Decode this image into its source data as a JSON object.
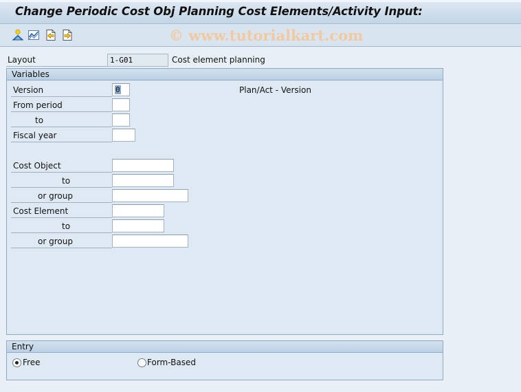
{
  "window": {
    "title": "Change Periodic Cost Obj Planning Cost Elements/Activity Input:"
  },
  "toolbar": {
    "icons": [
      {
        "name": "user-settings-icon",
        "label": "Settings"
      },
      {
        "name": "chart-icon",
        "label": "Graphic"
      },
      {
        "name": "previous-document-icon",
        "label": "Previous"
      },
      {
        "name": "next-document-icon",
        "label": "Next"
      }
    ],
    "watermark": "© www.tutorialkart.com"
  },
  "layout": {
    "label": "Layout",
    "value": "1-G01",
    "description": "Cost element planning"
  },
  "variables": {
    "title": "Variables",
    "version": {
      "label": "Version",
      "value": "0",
      "description": "Plan/Act - Version"
    },
    "from_period": {
      "label": "From period",
      "value": ""
    },
    "to_period": {
      "label": "to",
      "value": ""
    },
    "fiscal_year": {
      "label": "Fiscal year",
      "value": ""
    },
    "cost_object": {
      "label": "Cost Object",
      "value": ""
    },
    "cost_object_to": {
      "label": "to",
      "value": ""
    },
    "cost_object_group": {
      "label": "or group",
      "value": ""
    },
    "cost_element": {
      "label": "Cost Element",
      "value": ""
    },
    "cost_element_to": {
      "label": "to",
      "value": ""
    },
    "cost_element_group": {
      "label": "or group",
      "value": ""
    }
  },
  "entry": {
    "title": "Entry",
    "options": [
      {
        "label": "Free",
        "selected": true
      },
      {
        "label": "Form-Based",
        "selected": false
      }
    ]
  },
  "colors": {
    "background": "#e8eff6",
    "group_border": "#8fa8c6",
    "watermark": "#f2c9a0"
  }
}
